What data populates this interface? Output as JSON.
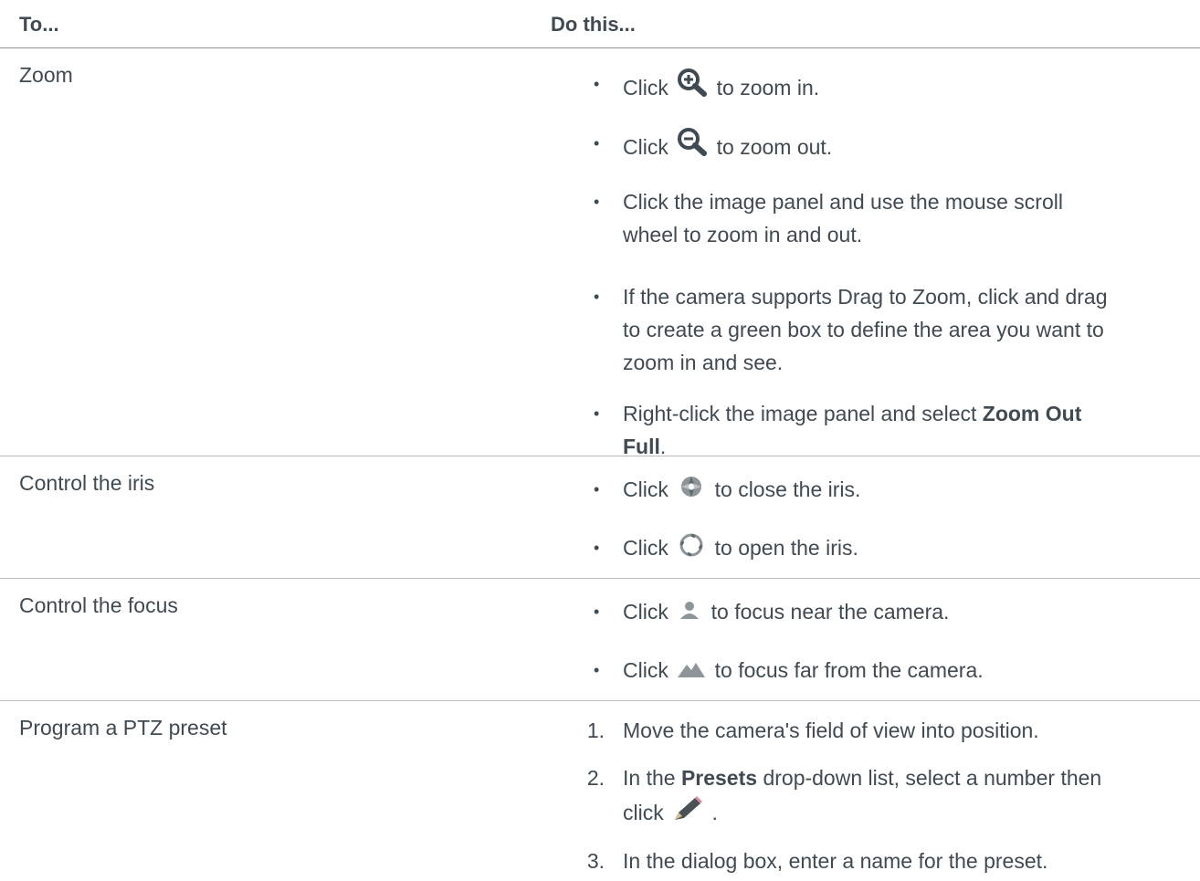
{
  "header": {
    "col1": "To...",
    "col2": "Do this..."
  },
  "rows": [
    {
      "label": "Zoom",
      "items": [
        {
          "pre": "Click",
          "post": "to zoom in.",
          "icon": "zoom-in-icon"
        },
        {
          "pre": "Click",
          "post": "to zoom out.",
          "icon": "zoom-out-icon"
        },
        {
          "text_l1": "Click the image panel and use the mouse scroll",
          "text_l2": "wheel to zoom in and out."
        },
        {
          "text_l1": "If the camera supports Drag to Zoom, click and drag",
          "text_l2": "to create a green box to define the area you want to",
          "text_l3": "zoom in and see."
        },
        {
          "text": "Right-click the image panel and select ",
          "bold": "Zoom Out",
          "bold2": "Full",
          "end": "."
        }
      ]
    },
    {
      "label": "Control the iris",
      "items": [
        {
          "pre": "Click",
          "post": "to close the iris.",
          "icon": "iris-close-icon"
        },
        {
          "pre": "Click",
          "post": "to open the iris.",
          "icon": "iris-open-icon"
        }
      ]
    },
    {
      "label": "Control the focus",
      "items": [
        {
          "pre": "Click",
          "post": "to focus near the camera.",
          "icon": "focus-near-icon"
        },
        {
          "pre": "Click",
          "post": "to focus far from the camera.",
          "icon": "focus-far-icon"
        }
      ]
    },
    {
      "label": "Program a PTZ preset",
      "items": [
        {
          "num": "1.",
          "text": "Move the camera's field of view into position."
        },
        {
          "num": "2.",
          "pre": "In the ",
          "bold": "Presets",
          "post": " drop-down list, select a number then",
          "l2": "click",
          "end": ".",
          "icon": "pencil-icon"
        },
        {
          "num": "3.",
          "text": "In the dialog box, enter a name for the preset."
        }
      ]
    }
  ],
  "bullet": "•"
}
